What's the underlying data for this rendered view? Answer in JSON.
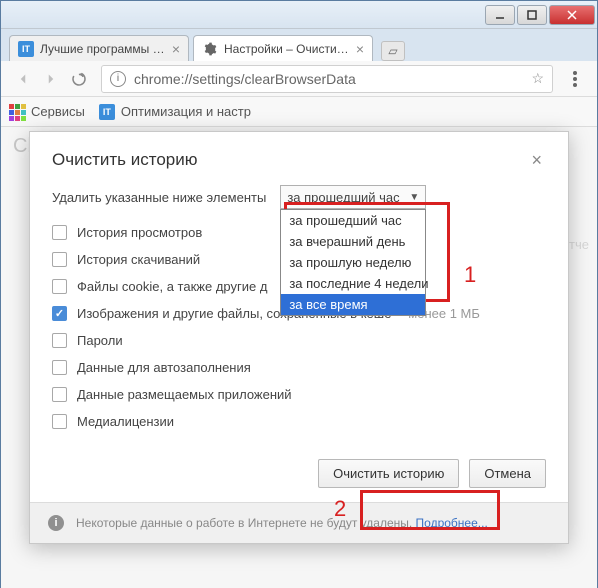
{
  "tabs": [
    {
      "title": "Лучшие программы дл…",
      "favicon": "IT"
    },
    {
      "title": "Настройки – Очистить и…",
      "favicon": "gear"
    }
  ],
  "omnibox": {
    "url": "chrome://settings/clearBrowserData"
  },
  "bookmarks": {
    "apps_label": "Сервисы",
    "items": [
      {
        "label": "Оптимизация и настр",
        "favicon": "IT"
      }
    ]
  },
  "content_bg_title": "Ch",
  "bg_right_text": "и отче",
  "dialog": {
    "title": "Очистить историю",
    "prompt": "Удалить указанные ниже элементы",
    "time_select": {
      "selected": "за прошедший час",
      "options": [
        "за прошедший час",
        "за вчерашний день",
        "за прошлую неделю",
        "за последние 4 недели",
        "за все время"
      ],
      "highlighted_index": 4
    },
    "checks": [
      {
        "label": "История просмотров",
        "checked": false
      },
      {
        "label": "История скачиваний",
        "checked": false
      },
      {
        "label": "Файлы cookie, а также другие д",
        "checked": false
      },
      {
        "label": "Изображения и другие файлы, сохраненные в кеше",
        "checked": true,
        "suffix": "– менее 1 МБ"
      },
      {
        "label": "Пароли",
        "checked": false
      },
      {
        "label": "Данные для автозаполнения",
        "checked": false
      },
      {
        "label": "Данные размещаемых приложений",
        "checked": false
      },
      {
        "label": "Медиалицензии",
        "checked": false
      }
    ],
    "actions": {
      "primary": "Очистить историю",
      "cancel": "Отмена"
    },
    "footer": {
      "text": "Некоторые данные о работе в Интернете не будут удалены. ",
      "link": "Подробнее..."
    }
  },
  "annotations": {
    "num1": "1",
    "num2": "2"
  }
}
